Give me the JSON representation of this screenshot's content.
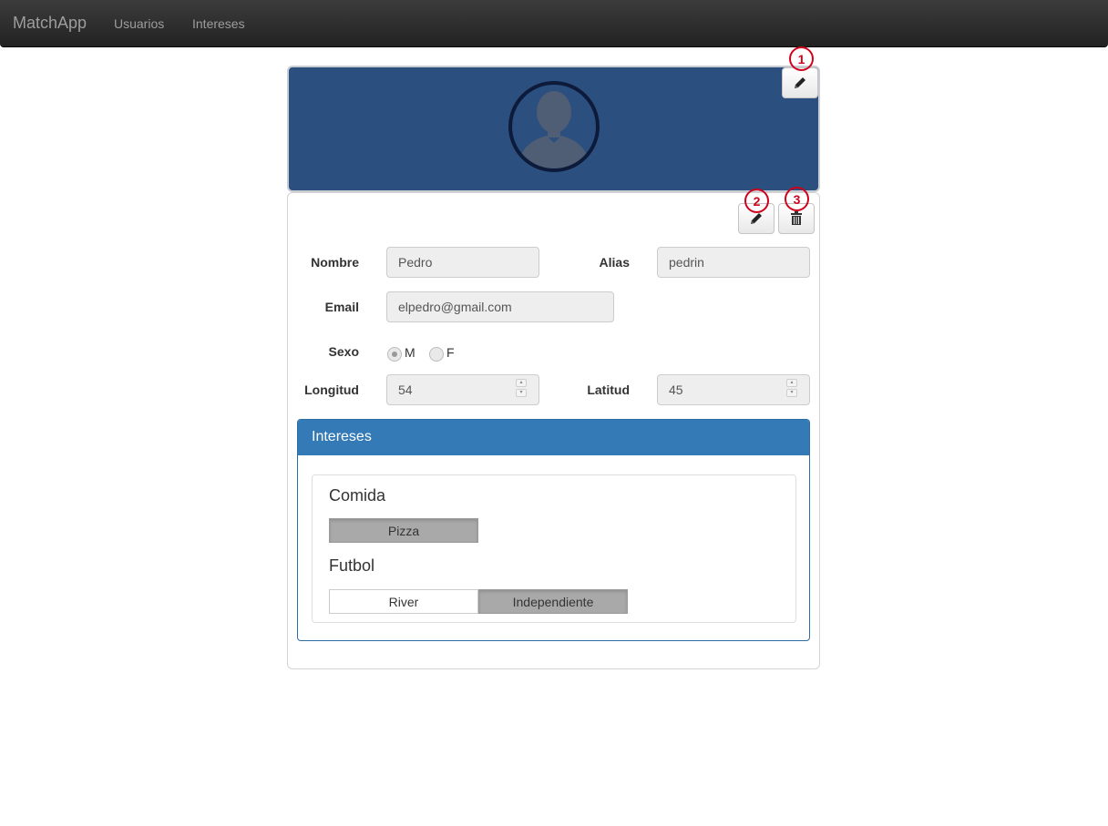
{
  "navbar": {
    "brand": "MatchApp",
    "links": [
      "Usuarios",
      "Intereses"
    ]
  },
  "markers": [
    "1",
    "2",
    "3"
  ],
  "icons": {
    "header_edit": "pencil-icon",
    "body_edit": "pencil-icon",
    "delete": "trash-icon"
  },
  "form": {
    "nombre_label": "Nombre",
    "nombre_value": "Pedro",
    "alias_label": "Alias",
    "alias_value": "pedrin",
    "email_label": "Email",
    "email_value": "elpedro@gmail.com",
    "sexo_label": "Sexo",
    "sexo_options": [
      "M",
      "F"
    ],
    "sexo_selected": "M",
    "longitud_label": "Longitud",
    "longitud_value": "54",
    "latitud_label": "Latitud",
    "latitud_value": "45"
  },
  "intereses": {
    "title": "Intereses",
    "categories": [
      {
        "name": "Comida",
        "items": [
          {
            "label": "Pizza",
            "selected": true
          }
        ]
      },
      {
        "name": "Futbol",
        "items": [
          {
            "label": "River",
            "selected": false
          },
          {
            "label": "Independiente",
            "selected": true
          }
        ]
      }
    ]
  },
  "colors": {
    "header_blue": "#2b4f7e",
    "panel_blue": "#337ab7",
    "marker_red": "#d0021b"
  }
}
